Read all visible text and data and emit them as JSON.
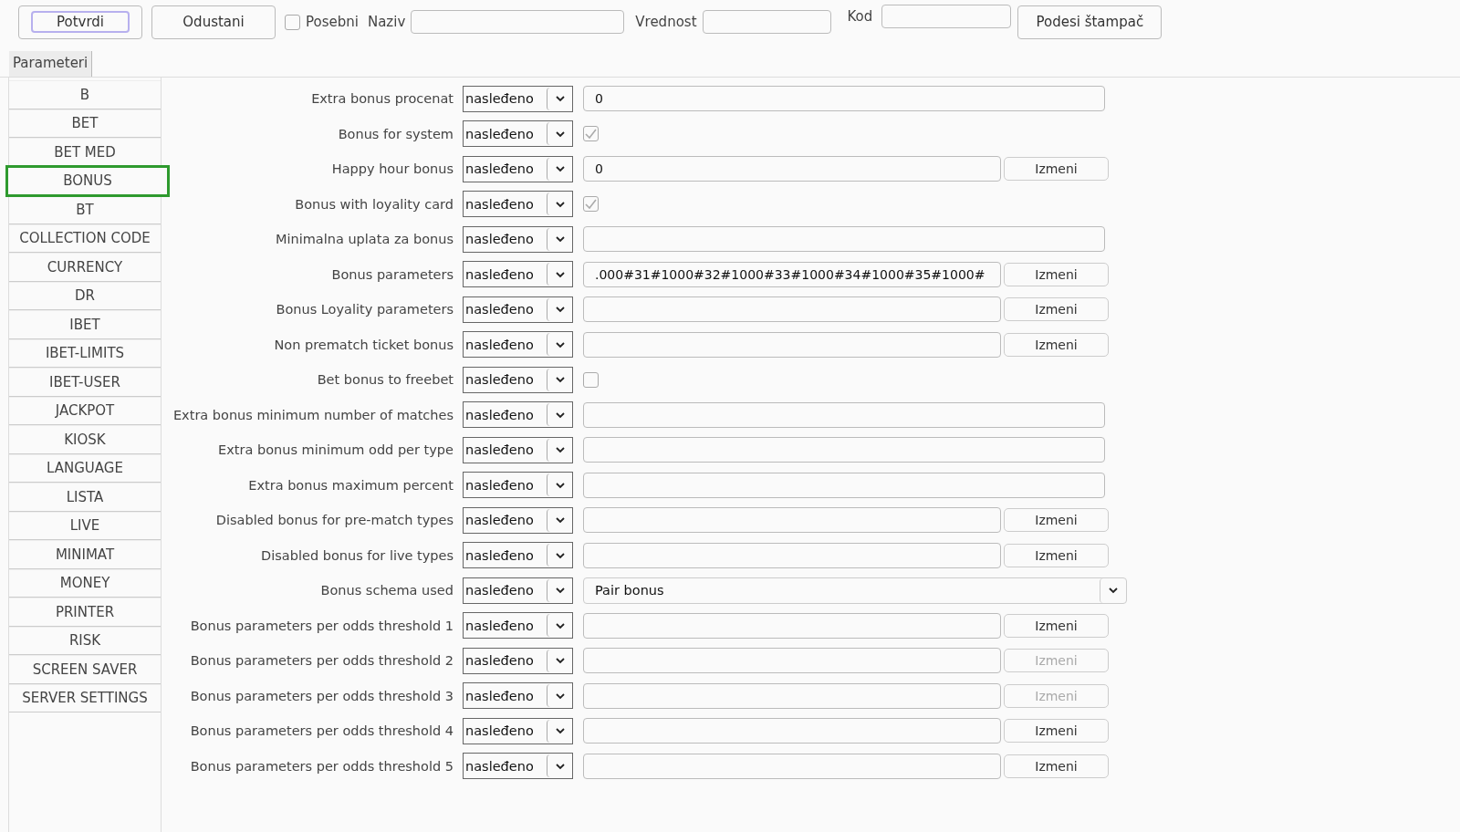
{
  "toolbar": {
    "confirm": "Potvrdi",
    "cancel": "Odustani",
    "special": {
      "label": "Posebni",
      "checked": false
    },
    "name_label": "Naziv",
    "value_label": "Vrednost",
    "code_label": "Kod",
    "printer": "Podesi štampač"
  },
  "tabs": [
    {
      "label": "Parameteri",
      "selected": true
    }
  ],
  "sidebar": {
    "items": [
      {
        "label": "B",
        "selected": false
      },
      {
        "label": "BET",
        "selected": false
      },
      {
        "label": "BET MED",
        "selected": false
      },
      {
        "label": "BONUS",
        "selected": true
      },
      {
        "label": "BT",
        "selected": false
      },
      {
        "label": "COLLECTION CODE",
        "selected": false
      },
      {
        "label": "CURRENCY",
        "selected": false
      },
      {
        "label": "DR",
        "selected": false
      },
      {
        "label": "IBET",
        "selected": false
      },
      {
        "label": "IBET-LIMITS",
        "selected": false
      },
      {
        "label": "IBET-USER",
        "selected": false
      },
      {
        "label": "JACKPOT",
        "selected": false
      },
      {
        "label": "KIOSK",
        "selected": false
      },
      {
        "label": "LANGUAGE",
        "selected": false
      },
      {
        "label": "LISTA",
        "selected": false
      },
      {
        "label": "LIVE",
        "selected": false
      },
      {
        "label": "MINIMAT",
        "selected": false
      },
      {
        "label": "MONEY",
        "selected": false
      },
      {
        "label": "PRINTER",
        "selected": false
      },
      {
        "label": "RISK",
        "selected": false
      },
      {
        "label": "SCREEN SAVER",
        "selected": false
      },
      {
        "label": "SERVER SETTINGS",
        "selected": false
      }
    ]
  },
  "params": [
    {
      "label": "Extra bonus procenat",
      "mode": "nasleđeno",
      "kind": "text",
      "value": "0"
    },
    {
      "label": "Bonus for system",
      "mode": "nasleđeno",
      "kind": "checkbox",
      "checked": true
    },
    {
      "label": "Happy hour bonus",
      "mode": "nasleđeno",
      "kind": "edit",
      "value": "0",
      "button": "Izmeni",
      "disabled": false
    },
    {
      "label": "Bonus with loyality card",
      "mode": "nasleđeno",
      "kind": "checkbox",
      "checked": true
    },
    {
      "label": "Minimalna uplata za bonus",
      "mode": "nasleđeno",
      "kind": "text"
    },
    {
      "label": "Bonus parameters",
      "mode": "nasleđeno",
      "kind": "edit",
      "value": ".000#31#1000#32#1000#33#1000#34#1000#35#1000#",
      "button": "Izmeni",
      "disabled": false
    },
    {
      "label": "Bonus Loyality parameters",
      "mode": "nasleđeno",
      "kind": "edit",
      "button": "Izmeni",
      "disabled": false
    },
    {
      "label": "Non prematch ticket bonus",
      "mode": "nasleđeno",
      "kind": "edit",
      "button": "Izmeni",
      "disabled": false
    },
    {
      "label": "Bet bonus to freebet",
      "mode": "nasleđeno",
      "kind": "checkbox",
      "checked": false
    },
    {
      "label": "Extra bonus minimum number of matches",
      "mode": "nasleđeno",
      "kind": "text"
    },
    {
      "label": "Extra bonus minimum odd per type",
      "mode": "nasleđeno",
      "kind": "text"
    },
    {
      "label": "Extra bonus maximum percent",
      "mode": "nasleđeno",
      "kind": "text"
    },
    {
      "label": "Disabled bonus for pre-match types",
      "mode": "nasleđeno",
      "kind": "edit",
      "button": "Izmeni",
      "disabled": false
    },
    {
      "label": "Disabled bonus for live types",
      "mode": "nasleđeno",
      "kind": "edit",
      "button": "Izmeni",
      "disabled": false
    },
    {
      "label": "Bonus schema used",
      "mode": "nasleđeno",
      "kind": "select",
      "value": "Pair bonus"
    },
    {
      "label": "Bonus parameters per odds threshold 1",
      "mode": "nasleđeno",
      "kind": "edit",
      "button": "Izmeni",
      "disabled": false
    },
    {
      "label": "Bonus parameters per odds threshold 2",
      "mode": "nasleđeno",
      "kind": "edit",
      "button": "Izmeni",
      "disabled": true
    },
    {
      "label": "Bonus parameters per odds threshold 3",
      "mode": "nasleđeno",
      "kind": "edit",
      "button": "Izmeni",
      "disabled": true
    },
    {
      "label": "Bonus parameters per odds threshold 4",
      "mode": "nasleđeno",
      "kind": "edit",
      "button": "Izmeni",
      "disabled": false
    },
    {
      "label": "Bonus parameters per odds threshold 5",
      "mode": "nasleđeno",
      "kind": "edit",
      "button": "Izmeni",
      "disabled": false
    }
  ]
}
